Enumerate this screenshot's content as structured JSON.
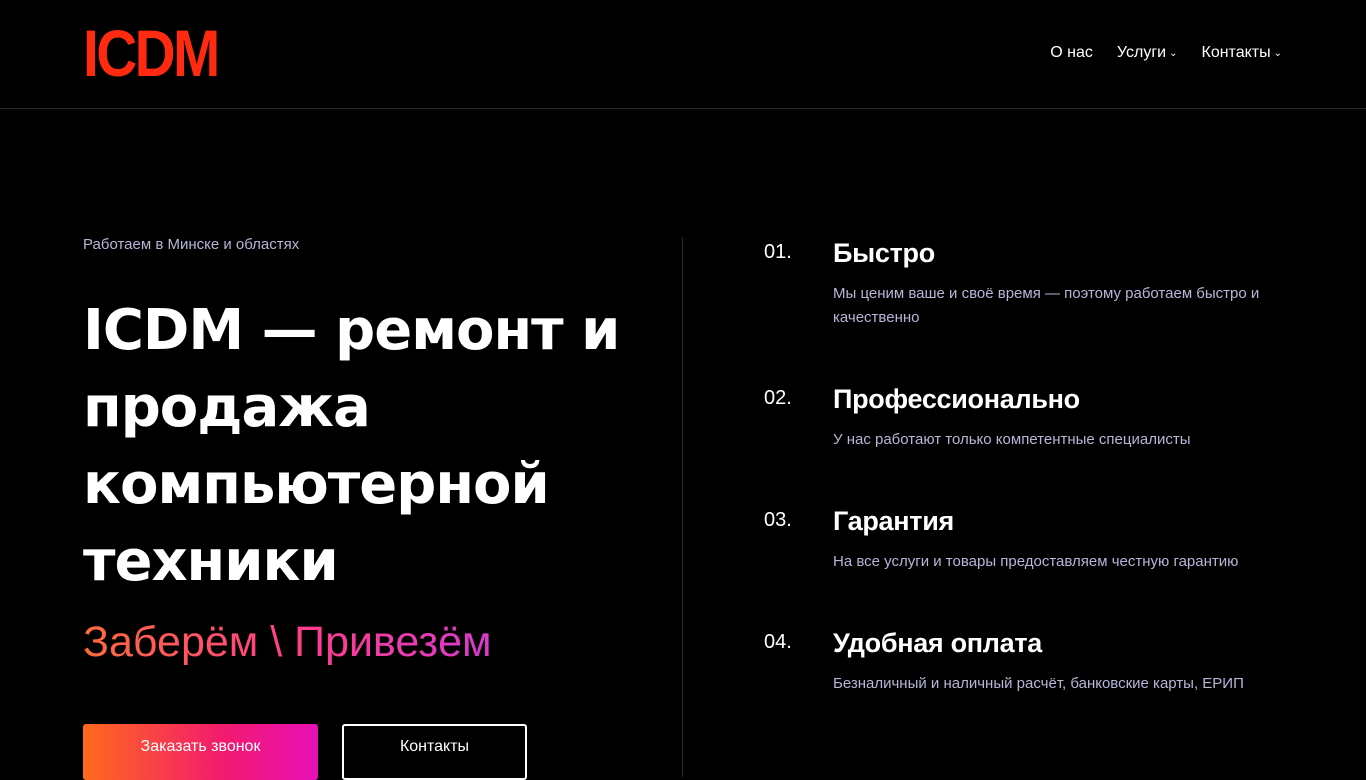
{
  "header": {
    "logo": "ICDM",
    "nav": [
      {
        "label": "О нас",
        "has_dropdown": false
      },
      {
        "label": "Услуги",
        "has_dropdown": true
      },
      {
        "label": "Контакты",
        "has_dropdown": true
      }
    ]
  },
  "hero": {
    "tagline": "Работаем в Минске и областях",
    "headline": "ICDM — ремонт и продажа компьютерной техники",
    "subline": "Заберём \\ Привезём",
    "buttons": {
      "call": "Заказать звонок",
      "contacts": "Контакты"
    }
  },
  "features": [
    {
      "num": "01.",
      "title": "Быстро",
      "desc": "Мы ценим ваше и своё время — поэтому работаем быстро и качественно"
    },
    {
      "num": "02.",
      "title": "Профессионально",
      "desc": "У нас работают только компетентные специалисты"
    },
    {
      "num": "03.",
      "title": "Гарантия",
      "desc": "На все услуги и товары предоставляем честную гарантию"
    },
    {
      "num": "04.",
      "title": "Удобная оплата",
      "desc": "Безналичный и наличный расчёт, банковские карты, ЕРИП"
    }
  ],
  "colors": {
    "brand": "#ff2a0f",
    "accent_gradient_start": "#ff6a1c",
    "accent_gradient_end": "#e810b8",
    "muted_text": "#b6b6d8"
  },
  "icons": {
    "dropdown": "chevron-down-icon"
  }
}
